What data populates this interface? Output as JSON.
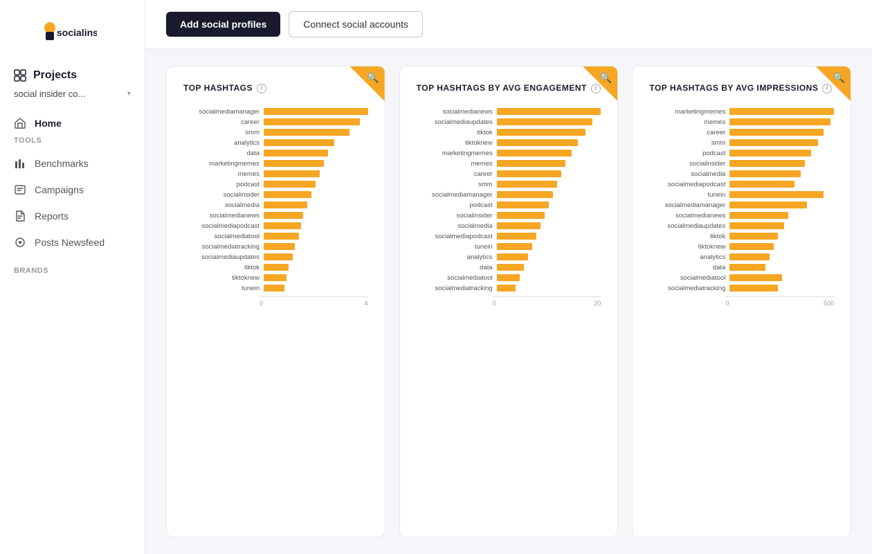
{
  "sidebar": {
    "logo_text": "socialinsider",
    "projects_label": "Projects",
    "project_name": "social insider co...",
    "tools_label": "TOOLS",
    "brands_label": "BRANDS",
    "nav_items": [
      {
        "id": "home",
        "label": "Home",
        "icon": "home"
      },
      {
        "id": "benchmarks",
        "label": "Benchmarks",
        "icon": "benchmarks"
      },
      {
        "id": "campaigns",
        "label": "Campaigns",
        "icon": "campaigns"
      },
      {
        "id": "reports",
        "label": "Reports",
        "icon": "reports"
      },
      {
        "id": "posts-newsfeed",
        "label": "Posts Newsfeed",
        "icon": "posts"
      }
    ]
  },
  "topbar": {
    "btn_add_label": "Add social profiles",
    "btn_connect_label": "Connect social accounts"
  },
  "charts": [
    {
      "id": "top-hashtags",
      "title": "TOP HASHTAGS",
      "max_value": 4,
      "axis_labels": [
        "0",
        "4"
      ],
      "bars": [
        {
          "label": "socialmediamanager",
          "value": 100
        },
        {
          "label": "career",
          "value": 92
        },
        {
          "label": "smm",
          "value": 82
        },
        {
          "label": "analytics",
          "value": 68
        },
        {
          "label": "data",
          "value": 62
        },
        {
          "label": "marketingmemes",
          "value": 58
        },
        {
          "label": "memes",
          "value": 54
        },
        {
          "label": "podcast",
          "value": 50
        },
        {
          "label": "socialinsider",
          "value": 46
        },
        {
          "label": "socialmedia",
          "value": 42
        },
        {
          "label": "socialmedianews",
          "value": 38
        },
        {
          "label": "socialmediapodcast",
          "value": 36
        },
        {
          "label": "socialmediatool",
          "value": 34
        },
        {
          "label": "socialmediatracking",
          "value": 30
        },
        {
          "label": "socialmediaupdates",
          "value": 28
        },
        {
          "label": "tiktok",
          "value": 24
        },
        {
          "label": "tiktoknew",
          "value": 22
        },
        {
          "label": "tunein",
          "value": 20
        }
      ]
    },
    {
      "id": "top-hashtags-engagement",
      "title": "TOP HASHTAGS BY AVG ENGAGEMENT",
      "max_value": 20,
      "axis_labels": [
        "0",
        "20"
      ],
      "bars": [
        {
          "label": "socialmedianews",
          "value": 100
        },
        {
          "label": "socialmediaupdates",
          "value": 92
        },
        {
          "label": "tiktok",
          "value": 85
        },
        {
          "label": "tiktoknew",
          "value": 78
        },
        {
          "label": "marketingmemes",
          "value": 72
        },
        {
          "label": "memes",
          "value": 66
        },
        {
          "label": "career",
          "value": 62
        },
        {
          "label": "smm",
          "value": 58
        },
        {
          "label": "socialmediamanager",
          "value": 54
        },
        {
          "label": "podcast",
          "value": 50
        },
        {
          "label": "socialinsider",
          "value": 46
        },
        {
          "label": "socialmedia",
          "value": 42
        },
        {
          "label": "socialmediapodcast",
          "value": 38
        },
        {
          "label": "tunein",
          "value": 34
        },
        {
          "label": "analytics",
          "value": 30
        },
        {
          "label": "data",
          "value": 26
        },
        {
          "label": "socialmediatool",
          "value": 22
        },
        {
          "label": "socialmediatracking",
          "value": 18
        }
      ]
    },
    {
      "id": "top-hashtags-impressions",
      "title": "TOP HASHTAGS BY AVG IMPRESSIONS",
      "max_value": 500,
      "axis_labels": [
        "0",
        "500"
      ],
      "bars": [
        {
          "label": "marketingmemes",
          "value": 100
        },
        {
          "label": "memes",
          "value": 97
        },
        {
          "label": "career",
          "value": 90
        },
        {
          "label": "smm",
          "value": 85
        },
        {
          "label": "podcast",
          "value": 78
        },
        {
          "label": "socialinsider",
          "value": 72
        },
        {
          "label": "socialmedia",
          "value": 68
        },
        {
          "label": "socialmediapodcast",
          "value": 62
        },
        {
          "label": "tunein",
          "value": 90
        },
        {
          "label": "socialmediamanager",
          "value": 74
        },
        {
          "label": "socialmedianews",
          "value": 56
        },
        {
          "label": "socialmediaupdates",
          "value": 52
        },
        {
          "label": "tiktok",
          "value": 46
        },
        {
          "label": "tiktoknew",
          "value": 42
        },
        {
          "label": "analytics",
          "value": 38
        },
        {
          "label": "data",
          "value": 34
        },
        {
          "label": "socialmediatool",
          "value": 50
        },
        {
          "label": "socialmediatracking",
          "value": 46
        }
      ]
    }
  ]
}
